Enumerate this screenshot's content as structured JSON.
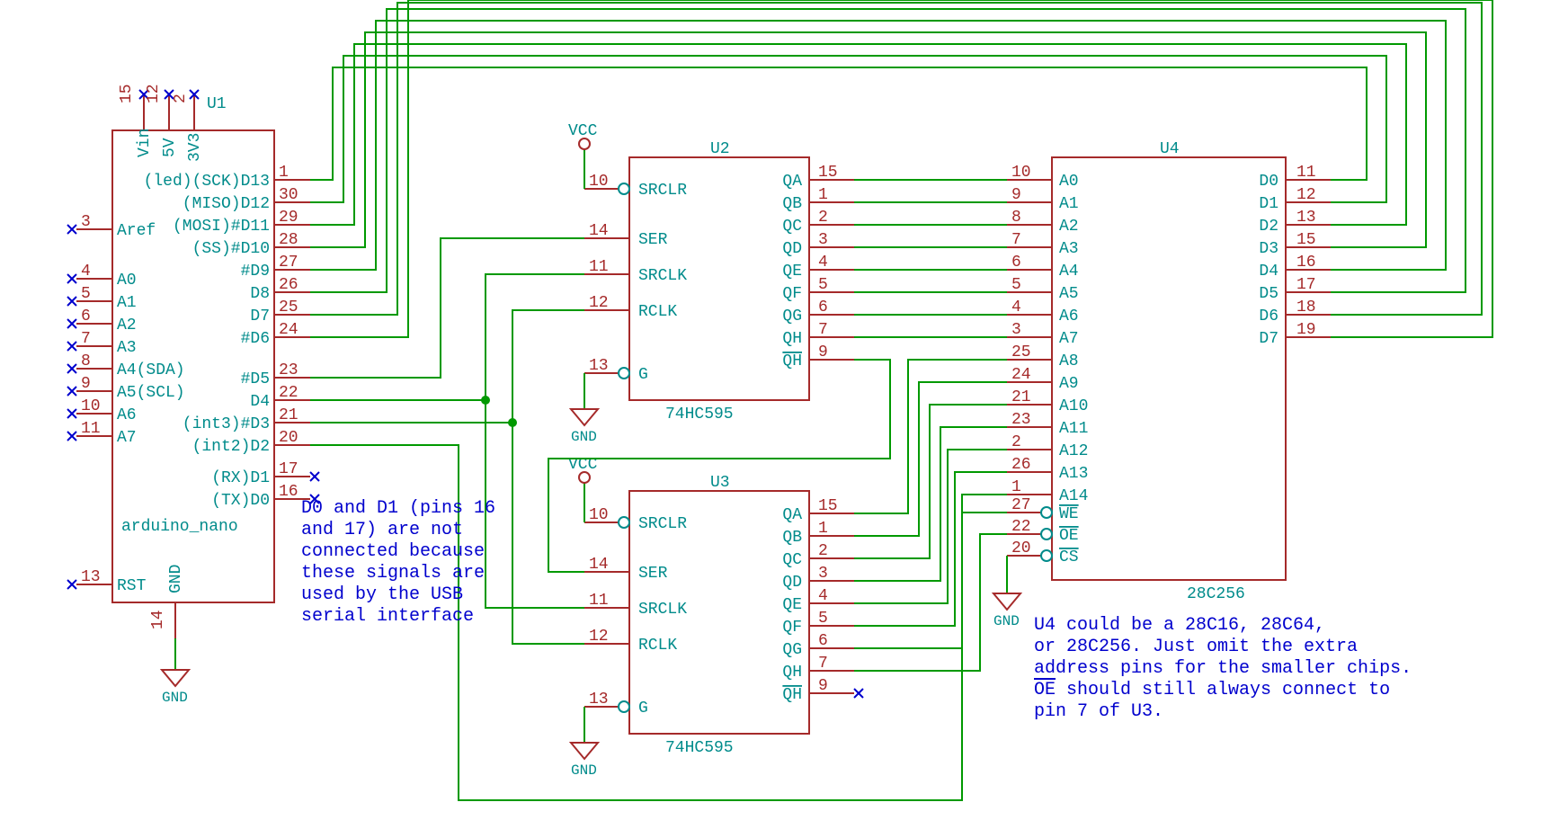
{
  "components": {
    "U1": {
      "ref": "U1",
      "part": "arduino_nano",
      "pins_left_top": [
        {
          "n": "15",
          "l": "Vin"
        },
        {
          "n": "12",
          "l": "5V"
        },
        {
          "n": "2",
          "l": "3V3"
        }
      ],
      "pins_left": [
        {
          "n": "3",
          "l": "Aref",
          "nc": true
        },
        {
          "n": "4",
          "l": "A0",
          "nc": true
        },
        {
          "n": "5",
          "l": "A1",
          "nc": true
        },
        {
          "n": "6",
          "l": "A2",
          "nc": true
        },
        {
          "n": "7",
          "l": "A3",
          "nc": true
        },
        {
          "n": "8",
          "l": "A4(SDA)",
          "nc": true
        },
        {
          "n": "9",
          "l": "A5(SCL)",
          "nc": true
        },
        {
          "n": "10",
          "l": "A6",
          "nc": true
        },
        {
          "n": "11",
          "l": "A7",
          "nc": true
        },
        {
          "n": "13",
          "l": "RST",
          "nc": true
        }
      ],
      "pins_right": [
        {
          "n": "1",
          "l": "(led)(SCK)D13"
        },
        {
          "n": "30",
          "l": "(MISO)D12"
        },
        {
          "n": "29",
          "l": "(MOSI)#D11"
        },
        {
          "n": "28",
          "l": "(SS)#D10"
        },
        {
          "n": "27",
          "l": "#D9"
        },
        {
          "n": "26",
          "l": "D8"
        },
        {
          "n": "25",
          "l": "D7"
        },
        {
          "n": "24",
          "l": "#D6"
        },
        {
          "n": "23",
          "l": "#D5"
        },
        {
          "n": "22",
          "l": "D4"
        },
        {
          "n": "21",
          "l": "(int3)#D3"
        },
        {
          "n": "20",
          "l": "(int2)D2"
        },
        {
          "n": "17",
          "l": "(RX)D1",
          "nc": true
        },
        {
          "n": "16",
          "l": "(TX)D0",
          "nc": true
        }
      ],
      "gnd_pin": "14",
      "gnd_label": "GND"
    },
    "U2": {
      "ref": "U2",
      "part": "74HC595",
      "left": [
        {
          "n": "10",
          "l": "SRCLR",
          "inv": true
        },
        {
          "n": "14",
          "l": "SER"
        },
        {
          "n": "11",
          "l": "SRCLK"
        },
        {
          "n": "12",
          "l": "RCLK"
        },
        {
          "n": "13",
          "l": "G",
          "inv": true
        }
      ],
      "right": [
        {
          "n": "15",
          "l": "QA"
        },
        {
          "n": "1",
          "l": "QB"
        },
        {
          "n": "2",
          "l": "QC"
        },
        {
          "n": "3",
          "l": "QD"
        },
        {
          "n": "4",
          "l": "QE"
        },
        {
          "n": "5",
          "l": "QF"
        },
        {
          "n": "6",
          "l": "QG"
        },
        {
          "n": "7",
          "l": "QH"
        },
        {
          "n": "9",
          "l": "QH",
          "over": true
        }
      ]
    },
    "U3": {
      "ref": "U3",
      "part": "74HC595",
      "left": [
        {
          "n": "10",
          "l": "SRCLR",
          "inv": true
        },
        {
          "n": "14",
          "l": "SER"
        },
        {
          "n": "11",
          "l": "SRCLK"
        },
        {
          "n": "12",
          "l": "RCLK"
        },
        {
          "n": "13",
          "l": "G",
          "inv": true
        }
      ],
      "right": [
        {
          "n": "15",
          "l": "QA"
        },
        {
          "n": "1",
          "l": "QB"
        },
        {
          "n": "2",
          "l": "QC"
        },
        {
          "n": "3",
          "l": "QD"
        },
        {
          "n": "4",
          "l": "QE"
        },
        {
          "n": "5",
          "l": "QF"
        },
        {
          "n": "6",
          "l": "QG"
        },
        {
          "n": "7",
          "l": "QH"
        },
        {
          "n": "9",
          "l": "QH",
          "over": true,
          "nc": true
        }
      ]
    },
    "U4": {
      "ref": "U4",
      "part": "28C256",
      "left_addr": [
        {
          "n": "10",
          "l": "A0"
        },
        {
          "n": "9",
          "l": "A1"
        },
        {
          "n": "8",
          "l": "A2"
        },
        {
          "n": "7",
          "l": "A3"
        },
        {
          "n": "6",
          "l": "A4"
        },
        {
          "n": "5",
          "l": "A5"
        },
        {
          "n": "4",
          "l": "A6"
        },
        {
          "n": "3",
          "l": "A7"
        },
        {
          "n": "25",
          "l": "A8"
        },
        {
          "n": "24",
          "l": "A9"
        },
        {
          "n": "21",
          "l": "A10"
        },
        {
          "n": "23",
          "l": "A11"
        },
        {
          "n": "2",
          "l": "A12"
        },
        {
          "n": "26",
          "l": "A13"
        },
        {
          "n": "1",
          "l": "A14"
        }
      ],
      "left_ctrl": [
        {
          "n": "27",
          "l": "WE",
          "over": true,
          "inv": true
        },
        {
          "n": "22",
          "l": "OE",
          "over": true,
          "inv": true
        },
        {
          "n": "20",
          "l": "CS",
          "over": true,
          "inv": true
        }
      ],
      "right_data": [
        {
          "n": "11",
          "l": "D0"
        },
        {
          "n": "12",
          "l": "D1"
        },
        {
          "n": "13",
          "l": "D2"
        },
        {
          "n": "15",
          "l": "D3"
        },
        {
          "n": "16",
          "l": "D4"
        },
        {
          "n": "17",
          "l": "D5"
        },
        {
          "n": "18",
          "l": "D6"
        },
        {
          "n": "19",
          "l": "D7"
        }
      ]
    }
  },
  "labels": {
    "vcc": "VCC",
    "gnd": "GND"
  },
  "notes": {
    "n1": [
      "D0 and D1 (pins 16",
      "and 17) are not",
      "connected because",
      "these signals are",
      "used by the USB",
      "serial interface"
    ],
    "n2": [
      "U4 could be a 28C16, 28C64,",
      "or 28C256. Just omit the extra",
      "address pins for the smaller chips.",
      "OE should still always connect to",
      "pin 7 of U3."
    ],
    "n2_overline_word": "OE"
  }
}
